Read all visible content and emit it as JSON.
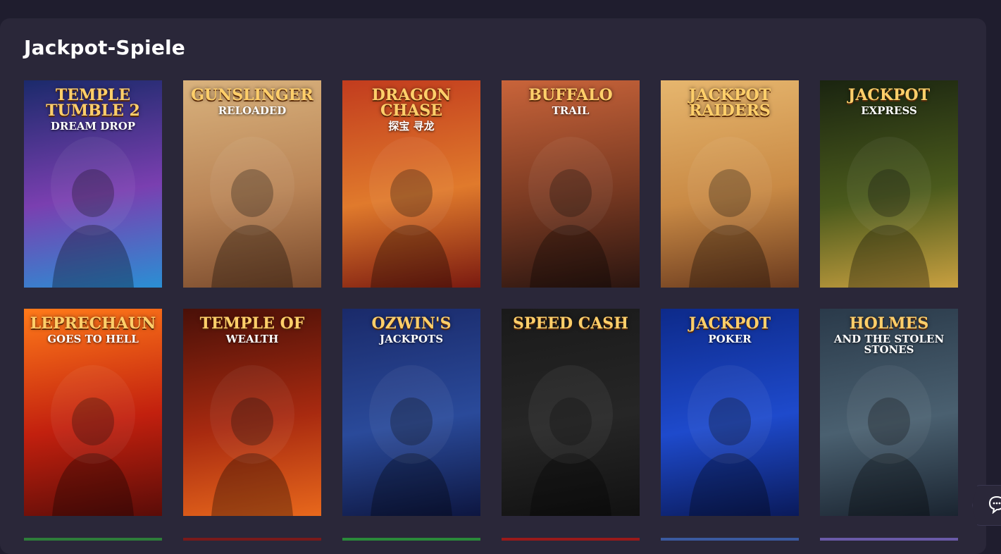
{
  "section": {
    "title": "Jackpot-Spiele"
  },
  "games": [
    {
      "name": "temple-tumble-2",
      "logo": "Temple Tumble 2",
      "sub": "Dream Drop",
      "colors": [
        "#1b2a6b",
        "#7a3fb0",
        "#2a8fd4"
      ]
    },
    {
      "name": "gunslinger-reloaded",
      "logo": "Gunslinger",
      "sub": "Reloaded",
      "colors": [
        "#d9b27d",
        "#b98456",
        "#7a4a2c"
      ]
    },
    {
      "name": "dragon-chase",
      "logo": "Dragon Chase",
      "sub": "探宝 寻龙",
      "colors": [
        "#c23c1e",
        "#e07a2c",
        "#7a1a10"
      ]
    },
    {
      "name": "buffalo-trail",
      "logo": "Buffalo",
      "sub": "Trail",
      "colors": [
        "#c9643a",
        "#7a3a22",
        "#2a1510"
      ]
    },
    {
      "name": "jackpot-raiders",
      "logo": "Jackpot Raiders",
      "sub": "",
      "colors": [
        "#e6b66e",
        "#c98a45",
        "#6a3a1e"
      ]
    },
    {
      "name": "jackpot-express",
      "logo": "Jackpot",
      "sub": "Express",
      "colors": [
        "#1a2410",
        "#4a5a1c",
        "#c9a040"
      ]
    },
    {
      "name": "leprechaun-goes-to-hell",
      "logo": "Leprechaun",
      "sub": "goes to Hell",
      "colors": [
        "#ff7a1a",
        "#c2200e",
        "#5a0c08"
      ]
    },
    {
      "name": "temple-of-wealth",
      "logo": "Temple of",
      "sub": "Wealth",
      "colors": [
        "#4a1008",
        "#a82a10",
        "#e8681c"
      ]
    },
    {
      "name": "ozwins-jackpots",
      "logo": "Ozwin's",
      "sub": "Jackpots",
      "colors": [
        "#1a2a6a",
        "#2a4a9a",
        "#0d1640"
      ]
    },
    {
      "name": "speed-cash",
      "logo": "Speed Cash",
      "sub": "",
      "colors": [
        "#1a1a1a",
        "#262626",
        "#111111"
      ]
    },
    {
      "name": "jackpot-poker",
      "logo": "Jackpot",
      "sub": "Poker",
      "colors": [
        "#0d2a8a",
        "#1e4acc",
        "#0a1a5a"
      ]
    },
    {
      "name": "holmes-and-the-stolen-stones",
      "logo": "Holmes",
      "sub": "and the Stolen Stones",
      "colors": [
        "#2a3a4a",
        "#4a6070",
        "#1a2430"
      ]
    }
  ],
  "partial_row_colors": [
    "#2e7d3a",
    "#7a1a1a",
    "#2a8a3a",
    "#9a1a1a",
    "#3a5aa0",
    "#6a5aa8"
  ],
  "chat": {
    "icon": "chat-bubble-icon"
  }
}
